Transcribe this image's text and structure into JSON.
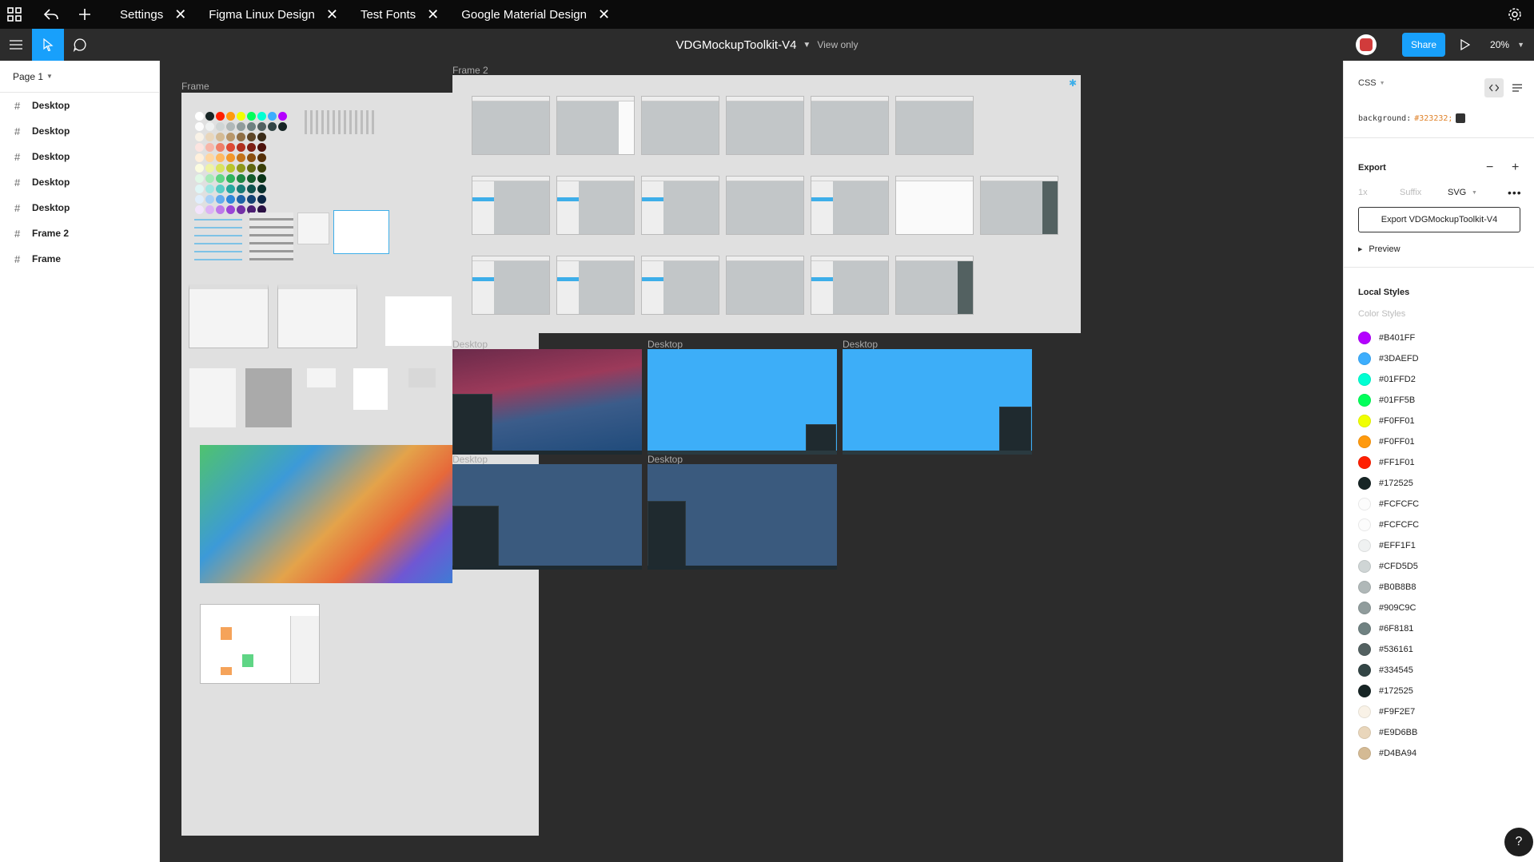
{
  "tabs": [
    {
      "label": "Settings"
    },
    {
      "label": "Figma Linux Design"
    },
    {
      "label": "Test Fonts"
    },
    {
      "label": "Google Material Design"
    }
  ],
  "toolbar": {
    "doc_name": "VDGMockupToolkit-V4",
    "view_mode": "View only",
    "share_label": "Share",
    "zoom": "20%"
  },
  "left_panel": {
    "page": "Page 1",
    "layers": [
      {
        "label": "Desktop"
      },
      {
        "label": "Desktop"
      },
      {
        "label": "Desktop"
      },
      {
        "label": "Desktop"
      },
      {
        "label": "Desktop"
      },
      {
        "label": "Frame 2"
      },
      {
        "label": "Frame"
      }
    ]
  },
  "canvas": {
    "frame_label": "Frame",
    "frame2_label": "Frame 2",
    "desktop_label": "Desktop"
  },
  "right_panel": {
    "code_lang": "CSS",
    "code_prop": "background:",
    "code_value": "#323232;",
    "export_title": "Export",
    "export_scale": "1x",
    "export_suffix": "Suffix",
    "export_format": "SVG",
    "export_button": "Export VDGMockupToolkit-V4",
    "preview_label": "Preview",
    "local_styles_title": "Local Styles",
    "color_styles_title": "Color Styles",
    "styles": [
      {
        "name": "#B401FF",
        "color": "#B401FF"
      },
      {
        "name": "#3DAEFD",
        "color": "#3DAEFD"
      },
      {
        "name": "#01FFD2",
        "color": "#01FFD2"
      },
      {
        "name": "#01FF5B",
        "color": "#01FF5B"
      },
      {
        "name": "#F0FF01",
        "color": "#F0FF01"
      },
      {
        "name": "#F0FF01",
        "color": "#FF9A0D"
      },
      {
        "name": "#FF1F01",
        "color": "#FF1F01"
      },
      {
        "name": "#172525",
        "color": "#172525"
      },
      {
        "name": "#FCFCFC",
        "color": "#FCFCFC"
      },
      {
        "name": "#FCFCFC",
        "color": "#FCFCFC"
      },
      {
        "name": "#EFF1F1",
        "color": "#EFF1F1"
      },
      {
        "name": "#CFD5D5",
        "color": "#CFD5D5"
      },
      {
        "name": "#B0B8B8",
        "color": "#B0B8B8"
      },
      {
        "name": "#909C9C",
        "color": "#909C9C"
      },
      {
        "name": "#6F8181",
        "color": "#6F8181"
      },
      {
        "name": "#536161",
        "color": "#536161"
      },
      {
        "name": "#334545",
        "color": "#334545"
      },
      {
        "name": "#172525",
        "color": "#172525"
      },
      {
        "name": "#F9F2E7",
        "color": "#F9F2E7"
      },
      {
        "name": "#E9D6BB",
        "color": "#E9D6BB"
      },
      {
        "name": "#D4BA94",
        "color": "#D4BA94"
      }
    ]
  },
  "colors": {
    "accent": "#18a0fb",
    "breeze_blue": "#3daee9",
    "canvas_bg": "#2c2c2c"
  }
}
